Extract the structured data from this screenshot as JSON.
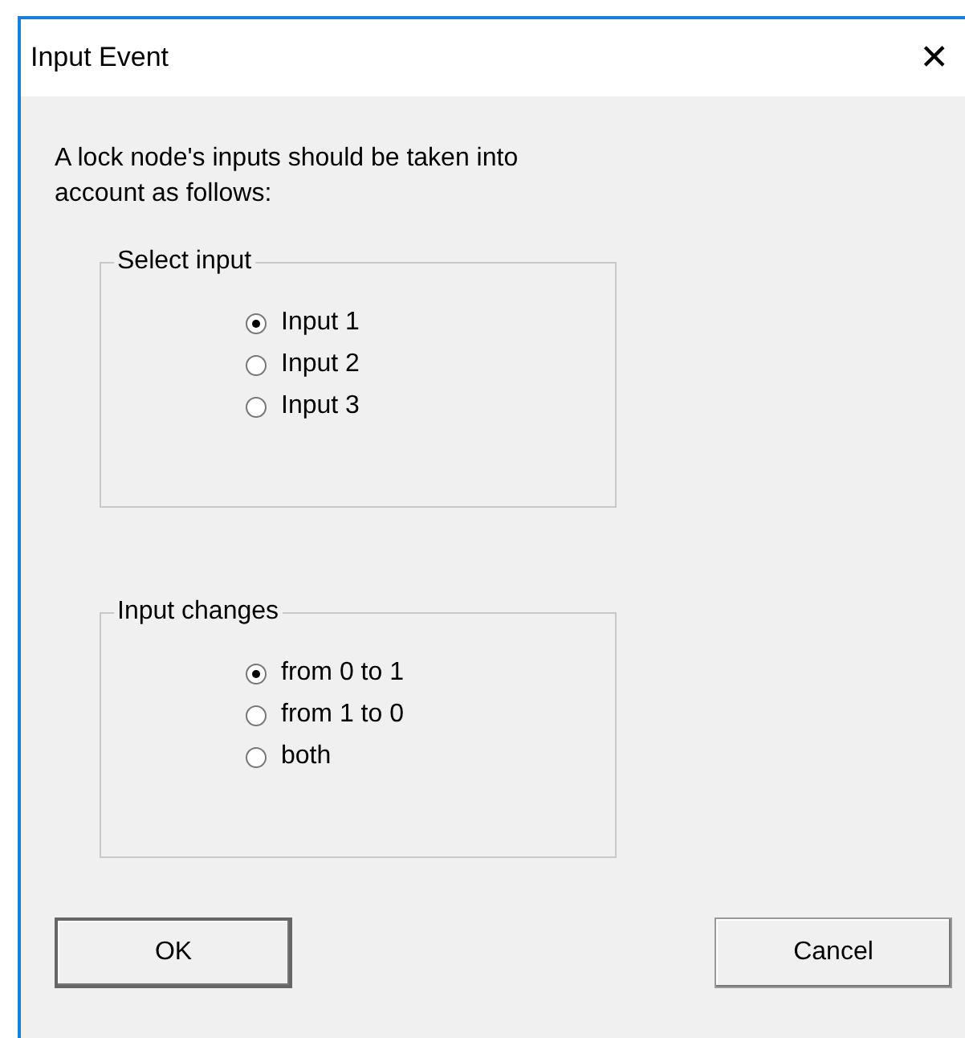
{
  "window": {
    "title": "Input Event",
    "close": "✕"
  },
  "intro": "A lock node's inputs should be taken into account as follows:",
  "groups": [
    {
      "title": "Select input",
      "options": [
        {
          "label": "Input 1",
          "selected": true
        },
        {
          "label": "Input 2",
          "selected": false
        },
        {
          "label": "Input 3",
          "selected": false
        }
      ]
    },
    {
      "title": "Input changes",
      "options": [
        {
          "label": "from 0 to 1",
          "selected": true
        },
        {
          "label": "from 1 to 0",
          "selected": false
        },
        {
          "label": "both",
          "selected": false
        }
      ]
    }
  ],
  "buttons": [
    {
      "label": "OK",
      "default": true
    },
    {
      "label": "Cancel",
      "default": false
    }
  ]
}
